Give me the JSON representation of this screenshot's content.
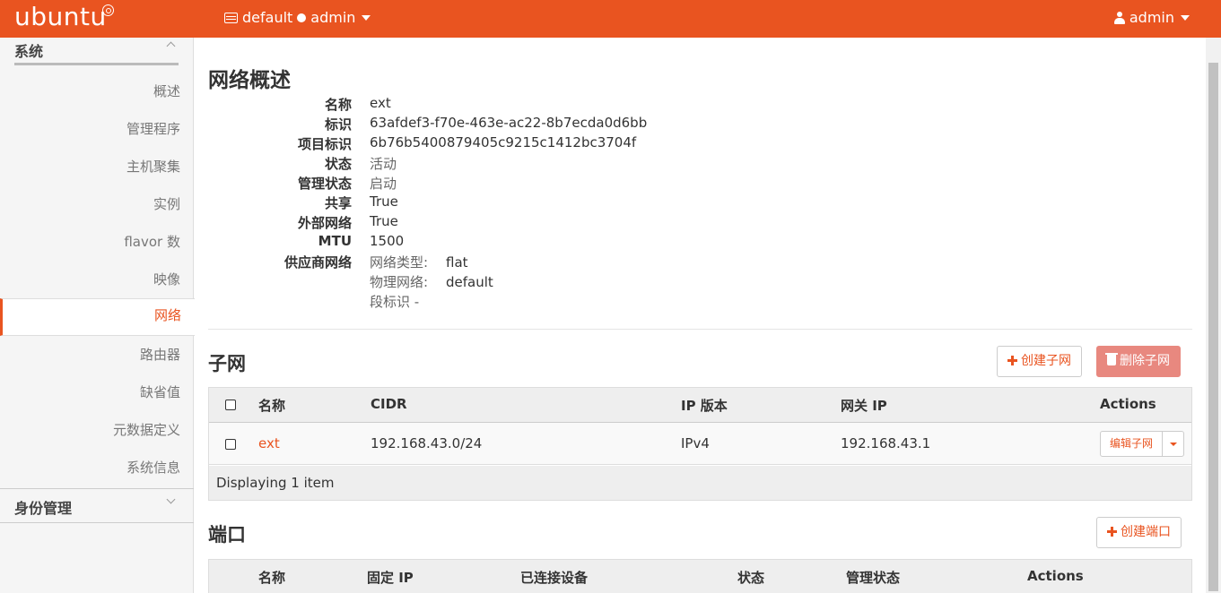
{
  "topbar": {
    "logo": "ubuntu",
    "project_domain": "default",
    "project_name": "admin",
    "user": "admin"
  },
  "sidebar": {
    "section_system": "系统",
    "items": [
      {
        "label": "概述"
      },
      {
        "label": "管理程序"
      },
      {
        "label": "主机聚集"
      },
      {
        "label": "实例"
      },
      {
        "label": "flavor 数"
      },
      {
        "label": "映像"
      },
      {
        "label": "网络",
        "active": true
      },
      {
        "label": "路由器"
      },
      {
        "label": "缺省值"
      },
      {
        "label": "元数据定义"
      },
      {
        "label": "系统信息"
      }
    ],
    "section_identity": "身份管理"
  },
  "overview": {
    "title": "网络概述",
    "fields": [
      {
        "term": "名称",
        "value": "ext"
      },
      {
        "term": "标识",
        "value": "63afdef3-f70e-463e-ac22-8b7ecda0d6bb"
      },
      {
        "term": "项目标识",
        "value": "6b76b5400879405c9215c1412bc3704f"
      },
      {
        "term": "状态",
        "value": "活动"
      },
      {
        "term": "管理状态",
        "value": "启动"
      },
      {
        "term": "共享",
        "value": "True"
      },
      {
        "term": "外部网络",
        "value": "True"
      },
      {
        "term": "MTU",
        "value": "1500"
      }
    ],
    "provider": {
      "term": "供应商网络",
      "network_type_label": "网络类型:",
      "network_type": "flat",
      "physical_network_label": "物理网络:",
      "physical_network": "default",
      "segment_label": "段标识 -"
    }
  },
  "subnets": {
    "title": "子网",
    "create_button": "创建子网",
    "delete_button": "删除子网",
    "columns": [
      "名称",
      "CIDR",
      "IP 版本",
      "网关 IP",
      "Actions"
    ],
    "rows": [
      {
        "name": "ext",
        "cidr": "192.168.43.0/24",
        "ip_version": "IPv4",
        "gateway": "192.168.43.1",
        "action": "编辑子网"
      }
    ],
    "footer": "Displaying 1 item"
  },
  "ports": {
    "title": "端口",
    "create_button": "创建端口",
    "columns": [
      "名称",
      "固定 IP",
      "已连接设备",
      "状态",
      "管理状态",
      "Actions"
    ]
  },
  "colors": {
    "brand": "#e95420",
    "danger": "#e8887f"
  }
}
